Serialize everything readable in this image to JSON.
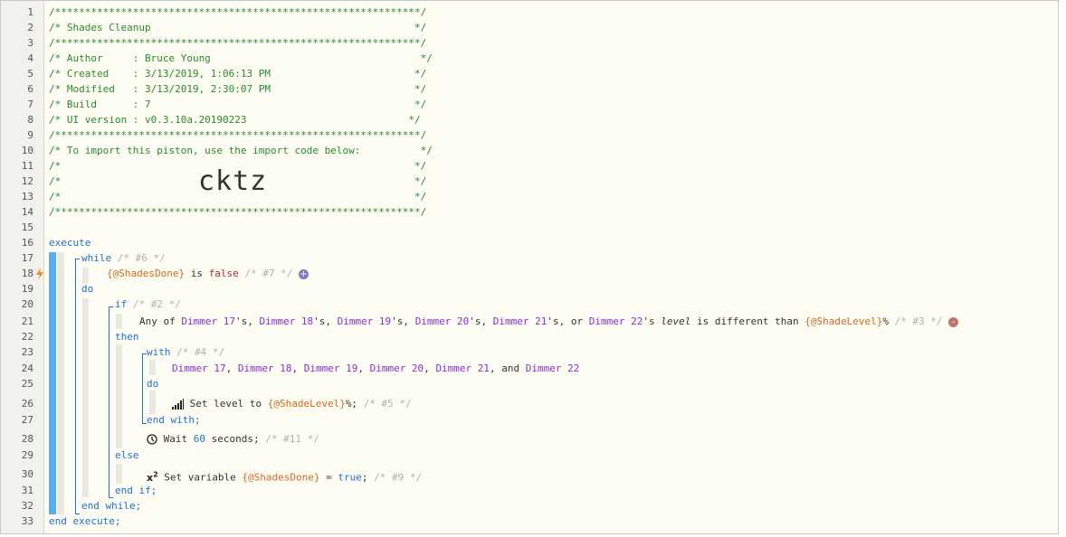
{
  "line_numbers": [
    "1",
    "2",
    "3",
    "4",
    "5",
    "6",
    "7",
    "8",
    "9",
    "10",
    "11",
    "12",
    "13",
    "14",
    "15",
    "16",
    "17",
    "18",
    "19",
    "20",
    "21",
    "22",
    "23",
    "24",
    "25",
    "26",
    "27",
    "28",
    "29",
    "30",
    "31",
    "32",
    "33"
  ],
  "header": {
    "border": "/*************************************************************/",
    "title": "/* Shades Cleanup                                            */",
    "author": "/* Author     : Bruce Young                                   */",
    "created": "/* Created    : 3/13/2019, 1:06:13 PM                        */",
    "modified": "/* Modified   : 3/13/2019, 2:30:07 PM                        */",
    "build": "/* Build      : 7                                            */",
    "ui_version": "/* UI version : v0.3.10a.20190223                           */",
    "import_note": "/* To import this piston, use the import code below:          */",
    "blank_comment": "/*                                                           */",
    "import_code": "cktz"
  },
  "code": {
    "execute": "execute",
    "while": "while",
    "while_comment": "/* #6 */",
    "var_shades_done": "{@ShadesDone}",
    "is": " is ",
    "false": "false",
    "cond_comment_7": " /* #7 */ ",
    "do": "do",
    "if": "if",
    "if_comment": "/* #2 */",
    "any_of": "Any of ",
    "d17": "Dimmer 17",
    "d18": "Dimmer 18",
    "d19": "Dimmer 19",
    "d20": "Dimmer 20",
    "d21": "Dimmer 21",
    "d22": "Dimmer 22",
    "poss": "'s, ",
    "poss_or": "'s, or ",
    "poss_last": "'s ",
    "level": "level",
    "different": " is different than ",
    "var_shade_level": "{@ShadeLevel}",
    "percent": "% ",
    "cond_comment_3": "/* #3 */ ",
    "then": "then",
    "with": "with",
    "with_comment": "/* #4 */",
    "sep": ", ",
    "and": ", and ",
    "set_level": " Set level to ",
    "pct_semi": "%; ",
    "comment_5": "/* #5 */",
    "end_with": "end with;",
    "wait": " Wait ",
    "wait_num": "60",
    "seconds": " seconds; ",
    "comment_11": "/* #11 */",
    "else": "else",
    "set_variable": " Set variable ",
    "eq": " = ",
    "true": "true",
    "semi": "; ",
    "comment_9": "/* #9 */",
    "end_if": "end if;",
    "end_while": "end while;",
    "end_execute": "end execute;",
    "add_badge": "+",
    "remove_badge": "-"
  },
  "colors": {
    "comment": "#2a8a2a",
    "keyword": "#1f6fd1",
    "variable": "#d2691e",
    "device": "#8a2be2",
    "block_bar": "#5aaef0",
    "badge_add": "#7a7fb5",
    "badge_remove": "#c0756a"
  },
  "icons": [
    "bolt-icon",
    "signal-bars-icon",
    "clock-icon",
    "superscript-x2-icon",
    "plus-badge-icon",
    "minus-badge-icon"
  ]
}
